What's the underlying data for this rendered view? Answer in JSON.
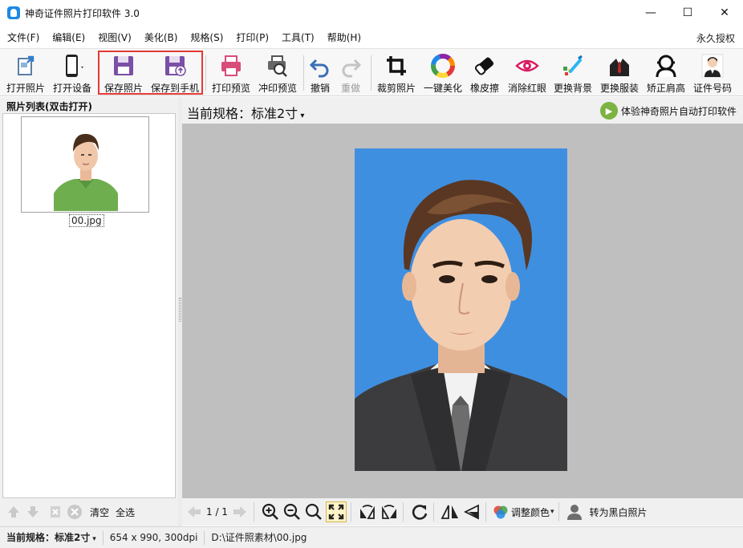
{
  "window": {
    "title": "神奇证件照片打印软件 3.0",
    "controls": [
      "—",
      "☐",
      "✕"
    ]
  },
  "menu": {
    "items": [
      "文件(F)",
      "编辑(E)",
      "视图(V)",
      "美化(B)",
      "规格(S)",
      "打印(P)",
      "工具(T)",
      "帮助(H)"
    ],
    "license": "永久授权"
  },
  "toolbar": {
    "open_photo": "打开照片",
    "open_device": "打开设备",
    "save_photo": "保存照片",
    "save_to_phone": "保存到手机",
    "print_preview": "打印预览",
    "develop_preview": "冲印预览",
    "undo": "撤销",
    "redo": "重做",
    "crop": "裁剪照片",
    "auto_beautify": "一键美化",
    "eraser": "橡皮擦",
    "red_eye": "消除红眼",
    "change_background": "更换背景",
    "change_clothes": "更换服装",
    "correct_shoulders": "矫正肩高",
    "id_number": "证件号码"
  },
  "left_panel": {
    "header": "照片列表(双击打开)",
    "thumb_name": "00.jpg",
    "clear": "清空",
    "select_all": "全选"
  },
  "main": {
    "spec_label": "当前规格：标准2寸",
    "auto_print_link": "体验神奇照片自动打印软件"
  },
  "view_tools": {
    "page": "1 / 1",
    "adjust_color": "调整颜色",
    "to_bw": "转为黑白照片"
  },
  "status": {
    "spec_label": "当前规格：",
    "spec_value": "标准2寸",
    "dims": "654 x 990, 300dpi",
    "path": "D:\\证件照素材\\00.jpg"
  },
  "colors": {
    "highlight": "#e53935",
    "photo_bg": "#3f8fe0",
    "save_purple": "#7b4fa6",
    "canvas": "#bfbfbf"
  }
}
